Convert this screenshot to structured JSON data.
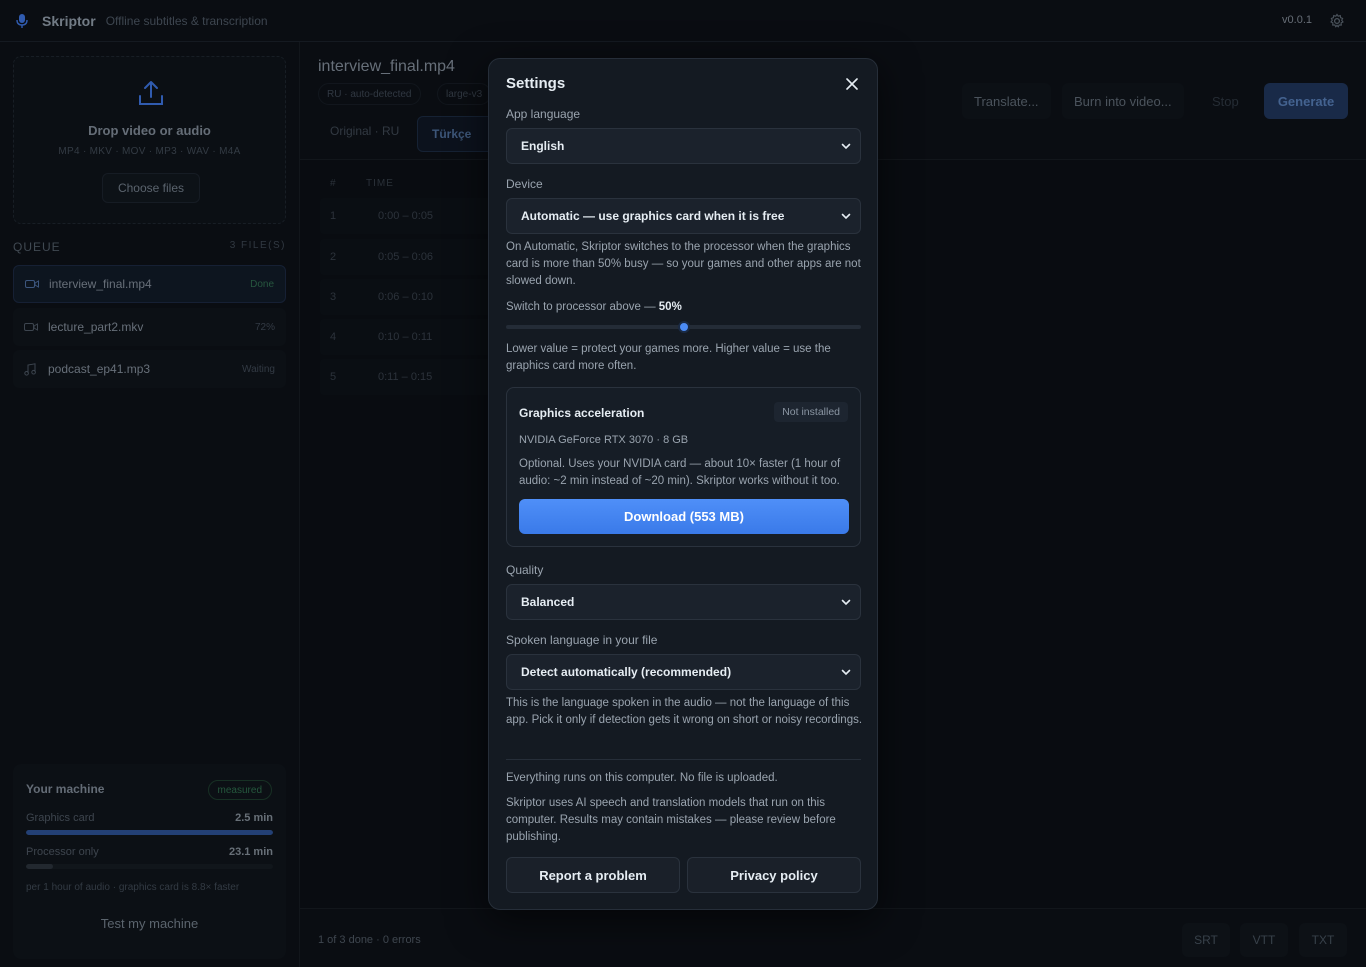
{
  "app": {
    "name": "Skriptor",
    "subtitle": "Offline subtitles & transcription",
    "version": "v0.0.1"
  },
  "sidebar": {
    "drop_title": "Drop video or audio",
    "drop_formats": "MP4 · MKV · MOV · MP3 · WAV · M4A",
    "choose_label": "Choose files",
    "queue_label": "QUEUE",
    "queue_count": "3 FILE(S)",
    "queue": [
      {
        "name": "interview_final.mp4",
        "status": "Done",
        "icon": "video-icon"
      },
      {
        "name": "lecture_part2.mkv",
        "status": "72%",
        "icon": "video-icon"
      },
      {
        "name": "podcast_ep41.mp3",
        "status": "Waiting",
        "icon": "music-icon"
      }
    ],
    "machine": {
      "title": "Your machine",
      "badge": "measured",
      "gpu_label": "Graphics card",
      "gpu_value": "2.5 min",
      "gpu_fill": 1.0,
      "cpu_label": "Processor only",
      "cpu_value": "23.1 min",
      "cpu_fill": 0.11,
      "note": "per 1 hour of audio · graphics card is 8.8× faster",
      "test_label": "Test my machine"
    }
  },
  "main": {
    "file_name": "interview_final.mp4",
    "chips": [
      "RU · auto-detected",
      "large-v3"
    ],
    "tabs": [
      "Original · RU",
      "Türkçe"
    ],
    "toolbar": {
      "translate": "Translate...",
      "burn": "Burn into video...",
      "stop": "Stop",
      "generate": "Generate"
    },
    "table_headers": {
      "num": "#",
      "time": "TIME"
    },
    "rows": [
      {
        "n": "1",
        "time": "0:00 – 0:05"
      },
      {
        "n": "2",
        "time": "0:05 – 0:06"
      },
      {
        "n": "3",
        "time": "0:06 – 0:10"
      },
      {
        "n": "4",
        "time": "0:10 – 0:11"
      },
      {
        "n": "5",
        "time": "0:11 – 0:15"
      }
    ],
    "footer_status": "1 of 3 done · 0 errors",
    "export": [
      "SRT",
      "VTT",
      "TXT"
    ]
  },
  "settings": {
    "title": "Settings",
    "app_language_label": "App language",
    "app_language_value": "English",
    "device_label": "Device",
    "device_value": "Automatic — use graphics card when it is free",
    "device_help": "On Automatic, Skriptor switches to the processor when the graphics card is more than 50% busy — so your games and other apps are not slowed down.",
    "switch_label": "Switch to processor above —",
    "switch_value": "50%",
    "switch_fraction": 0.5,
    "slider_help": "Lower value = protect your games more. Higher value = use the graphics card more often.",
    "gpu": {
      "title": "Graphics acceleration",
      "status": "Not installed",
      "card": "NVIDIA GeForce RTX 3070 · 8 GB",
      "desc": "Optional. Uses your NVIDIA card — about 10× faster (1 hour of audio: ~2 min instead of ~20 min). Skriptor works without it too.",
      "download": "Download (553 MB)"
    },
    "quality_label": "Quality",
    "quality_value": "Balanced",
    "spoken_label": "Spoken language in your file",
    "spoken_value": "Detect automatically (recommended)",
    "spoken_help": "This is the language spoken in the audio — not the language of this app. Pick it only if detection gets it wrong on short or noisy recordings.",
    "privacy_note": "Everything runs on this computer. No file is uploaded.",
    "ai_note": "Skriptor uses AI speech and translation models that run on this computer. Results may contain mistakes — please review before publishing.",
    "report_label": "Report a problem",
    "privacy_label": "Privacy policy"
  },
  "colors": {
    "accent": "#4b8bf5",
    "background": "#0b0f15",
    "modal": "#141a22",
    "success": "#2f6a4d"
  }
}
